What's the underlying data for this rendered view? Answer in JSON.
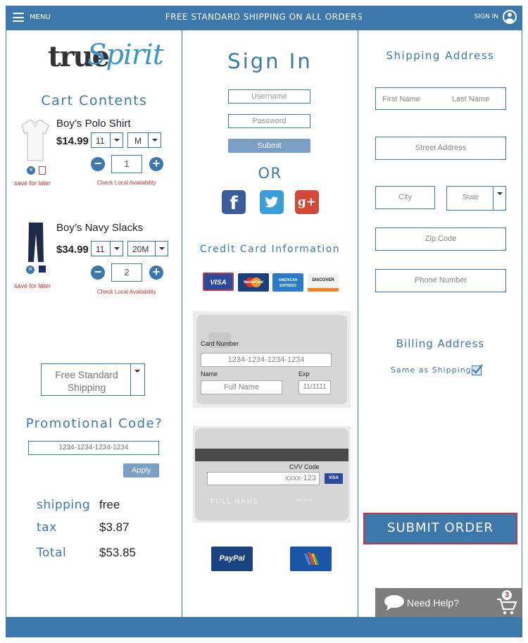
{
  "header": {
    "menu_label": "MENU",
    "promo": "FREE STANDARD SHIPPING ON ALL ORDERS",
    "signin_label": "SIGN IN"
  },
  "brand": {
    "logo_part1": "true",
    "logo_part2": "Spirit"
  },
  "cart": {
    "title": "Cart Contents",
    "items": [
      {
        "name": "Boy’s Polo Shirt",
        "price": "$14.99",
        "size": "11",
        "fit": "M",
        "qty": "1",
        "save_label": "save for later",
        "availability_label": "Check Local Availability"
      },
      {
        "name": "Boy’s Navy Slacks",
        "price": "$34.99",
        "size": "11",
        "fit": "20M",
        "qty": "2",
        "save_label": "save for later",
        "availability_label": "Check Local Availability"
      }
    ],
    "shipping_method_line1": "Free Standard",
    "shipping_method_line2": "Shipping",
    "promo_title": "Promotional Code?",
    "promo_placeholder": "1234-1234-1234-1234",
    "apply_label": "Apply",
    "summary": {
      "shipping_label": "shipping",
      "shipping_value": "free",
      "tax_label": "tax",
      "tax_value": "$3.87",
      "total_label": "Total",
      "total_value": "$53.85"
    }
  },
  "signin": {
    "title": "Sign In",
    "username_placeholder": "Username",
    "password_placeholder": "Password",
    "submit_label": "Submit",
    "or_label": "OR"
  },
  "payment": {
    "title": "Credit Card Information",
    "card_logos": [
      "VISA",
      "MasterCard",
      "AMERICAN EXPRESS",
      "DISCOVER"
    ],
    "card_number_label": "Card Number",
    "card_number_placeholder": "1234-1234-1234-1234",
    "name_label": "Name",
    "name_placeholder": "Full Name",
    "exp_label": "Exp",
    "exp_placeholder": "11/1111",
    "cvv_label": "CVV Code",
    "cvv_placeholder": "xxxx-123",
    "cvv_visa": "VISA",
    "back_full_name": "FULL NAME",
    "back_exp": "**/**",
    "paypal_label": "PayPal"
  },
  "shipping": {
    "title": "Shipping Address",
    "first_name": "First Name",
    "last_name": "Last Name",
    "street": "Street  Address",
    "city": "City",
    "state": "State",
    "zip": "Zip Code",
    "phone": "Phone Number"
  },
  "billing": {
    "title": "Billing Address",
    "same_label": "Same as Shipping"
  },
  "actions": {
    "submit_order": "SUBMIT ORDER",
    "need_help": "Need Help?",
    "cart_count": "3"
  },
  "colors": {
    "primary": "#3d78ad",
    "accent_red": "#c0394a",
    "help_grey": "#7d7d7d"
  }
}
